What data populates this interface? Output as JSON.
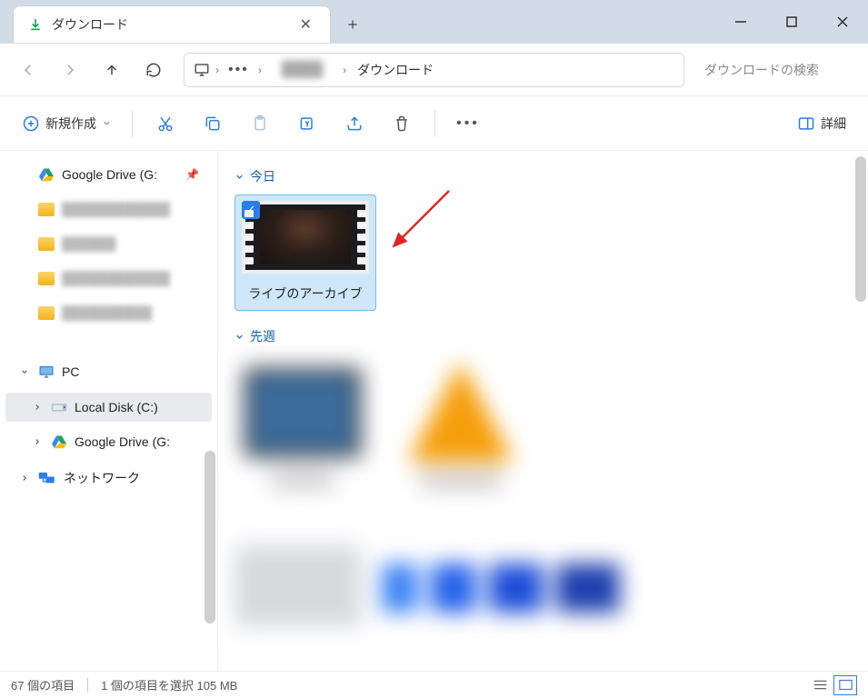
{
  "window": {
    "tab_title": "ダウンロード",
    "search_placeholder": "ダウンロードの検索"
  },
  "breadcrumbs": {
    "current": "ダウンロード"
  },
  "toolbar": {
    "new_label": "新規作成",
    "details_label": "詳細"
  },
  "sidebar": {
    "gdrive_pinned": "Google Drive (G:",
    "pc": "PC",
    "local_disk": "Local Disk (C:)",
    "gdrive": "Google Drive (G:",
    "network": "ネットワーク"
  },
  "content": {
    "group_today": "今日",
    "group_lastweek": "先週",
    "selected_file": "ライブのアーカイブ"
  },
  "status": {
    "items": "67 個の項目",
    "selection": "1 個の項目を選択 105 MB"
  }
}
